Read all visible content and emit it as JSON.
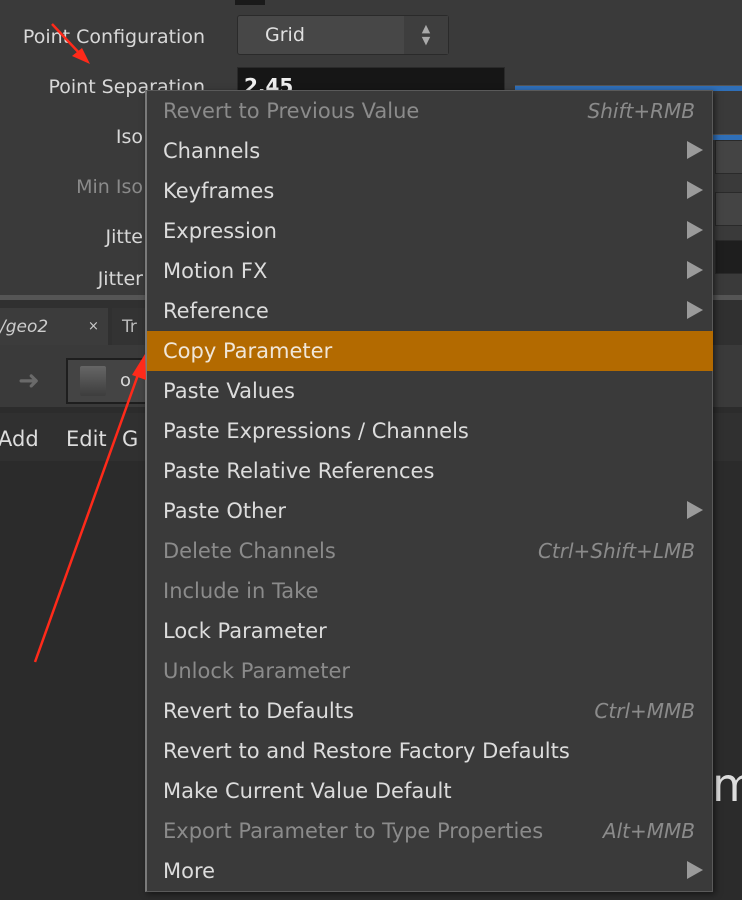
{
  "params": {
    "point_configuration_label": "Point Configuration",
    "point_configuration_value": "Grid",
    "point_separation_label": "Point Separation",
    "point_separation_value": "2.45",
    "iso_label": "Iso",
    "min_iso_label": "Min Iso",
    "jitter_label": "Jitte",
    "jitter2_label": "Jitter"
  },
  "tabs": [
    {
      "label": "/geo2",
      "close": "×"
    },
    {
      "label": "Tr"
    }
  ],
  "path": {
    "label": "o"
  },
  "menubar": {
    "items": [
      "Add",
      "Edit",
      "G"
    ]
  },
  "network": {
    "partial_text": "m"
  },
  "context_menu": {
    "highlight_color": "#b36a00",
    "items": [
      {
        "label": "Revert to Previous Value",
        "shortcut": "Shift+RMB",
        "disabled": true
      },
      {
        "label": "Channels",
        "submenu": true
      },
      {
        "label": "Keyframes",
        "submenu": true
      },
      {
        "label": "Expression",
        "submenu": true
      },
      {
        "label": "Motion FX",
        "submenu": true
      },
      {
        "label": "Reference",
        "submenu": true
      },
      {
        "label": "Copy Parameter",
        "highlighted": true
      },
      {
        "label": "Paste Values"
      },
      {
        "label": "Paste Expressions / Channels"
      },
      {
        "label": "Paste Relative References"
      },
      {
        "label": "Paste Other",
        "submenu": true
      },
      {
        "label": "Delete Channels",
        "shortcut": "Ctrl+Shift+LMB",
        "disabled": true
      },
      {
        "label": "Include in Take",
        "disabled": true
      },
      {
        "label": "Lock Parameter"
      },
      {
        "label": "Unlock Parameter",
        "disabled": true
      },
      {
        "label": "Revert to Defaults",
        "shortcut": "Ctrl+MMB"
      },
      {
        "label": "Revert to and Restore Factory Defaults"
      },
      {
        "label": "Make Current Value Default"
      },
      {
        "label": "Export Parameter to Type Properties",
        "shortcut": "Alt+MMB",
        "disabled": true
      },
      {
        "label": "More",
        "submenu": true
      }
    ]
  },
  "annotation_color": "#ff2a1a"
}
